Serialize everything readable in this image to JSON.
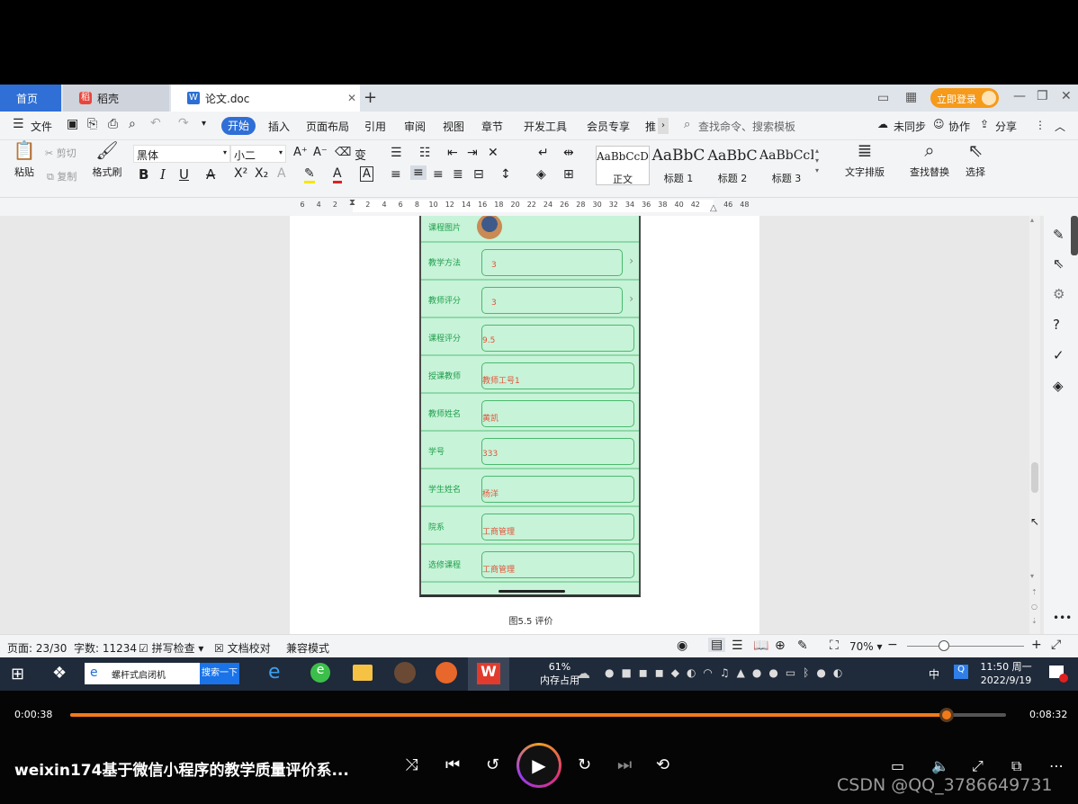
{
  "tabs": {
    "home": "首页",
    "daoke": "稻壳",
    "doc": "论文.doc",
    "login": "立即登录"
  },
  "menu": {
    "file": "文件",
    "start": "开始",
    "insert": "插入",
    "layout": "页面布局",
    "ref": "引用",
    "review": "审阅",
    "view": "视图",
    "chapter": "章节",
    "dev": "开发工具",
    "vip": "会员专享",
    "more": "推",
    "search_placeholder": "查找命令、搜索模板",
    "unsync": "未同步",
    "collab": "协作",
    "share": "分享"
  },
  "ribbon": {
    "paste": "粘贴",
    "cut": "剪切",
    "copy": "复制",
    "format_painter": "格式刷",
    "font": "黑体",
    "size": "小二",
    "styles": [
      {
        "sample": "AaBbCcDd",
        "label": "正文"
      },
      {
        "sample": "AaBbC",
        "label": "标题 1"
      },
      {
        "sample": "AaBbC",
        "label": "标题 2"
      },
      {
        "sample": "AaBbCcI",
        "label": "标题 3"
      }
    ],
    "text_layout": "文字排版",
    "find_replace": "查找替换",
    "select": "选择"
  },
  "ruler": {
    "ticks": [
      "6",
      "4",
      "2",
      "",
      "2",
      "4",
      "6",
      "8",
      "10",
      "12",
      "14",
      "16",
      "18",
      "20",
      "22",
      "24",
      "26",
      "28",
      "30",
      "32",
      "34",
      "36",
      "38",
      "40",
      "42",
      "",
      "46",
      "48"
    ]
  },
  "phone": {
    "image_label": "课程图片",
    "fields": [
      {
        "label": "教学方法",
        "value": "3",
        "chevron": true
      },
      {
        "label": "教师评分",
        "value": "3",
        "chevron": true
      },
      {
        "label": "课程评分",
        "value": "9.5",
        "chevron": false
      },
      {
        "label": "授课教师",
        "value": "教师工号1",
        "chevron": false
      },
      {
        "label": "教师姓名",
        "value": "黄凯",
        "chevron": false
      },
      {
        "label": "学号",
        "value": "333",
        "chevron": false
      },
      {
        "label": "学生姓名",
        "value": "杨洋",
        "chevron": false
      },
      {
        "label": "院系",
        "value": "工商管理",
        "chevron": false
      },
      {
        "label": "选修课程",
        "value": "工商管理",
        "chevron": false
      }
    ]
  },
  "caption": "图5.5  评价",
  "status": {
    "page": "页面: 23/30",
    "words": "字数: 11234",
    "spell": "拼写检查",
    "proof": "文档校对",
    "compat": "兼容模式",
    "zoom": "70%"
  },
  "taskbar": {
    "search_text": "螺杆式启闭机",
    "search_button": "搜索一下",
    "mem_pct": "61%",
    "mem_label": "内存占用",
    "ime": "中",
    "time": "11:50 周一",
    "date": "2022/9/19"
  },
  "player": {
    "elapsed": "0:00:38",
    "total": "0:08:32",
    "progress": 0.937,
    "title": "weixin174基于微信小程序的教学质量评价系...",
    "watermark": "CSDN @QQ_3786649731"
  },
  "colors": {
    "accent": "#1a73e8",
    "progress": "#f07a1a",
    "phone_bg": "#c7f3d8",
    "label": "#1e9e4a",
    "value": "#e0543a"
  }
}
